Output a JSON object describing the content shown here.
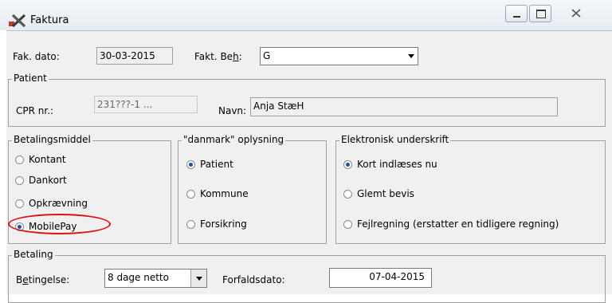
{
  "window": {
    "title": "Faktura",
    "icon": "faktura-x-icon"
  },
  "header": {
    "fak_dato_label": "Fak. dato:",
    "fak_dato_value": "30-03-2015",
    "fakt_beh_label_pre": "Fakt. Be",
    "fakt_beh_label_u": "h",
    "fakt_beh_label_post": ":",
    "fakt_beh_value": "G"
  },
  "patient": {
    "legend": "Patient",
    "cpr_label": "CPR nr.:",
    "cpr_value": "231???-1 ...",
    "navn_label": "Navn:",
    "navn_value": "Anja StæH"
  },
  "betalingsmiddel": {
    "legend": "Betalingsmiddel",
    "options": [
      "Kontant",
      "Dankort",
      "Opkrævning",
      "MobilePay"
    ],
    "selected": "MobilePay"
  },
  "danmark": {
    "legend": "\"danmark\" oplysning",
    "options": [
      "Patient",
      "Kommune",
      "Forsikring"
    ],
    "selected": "Patient"
  },
  "underskrift": {
    "legend": "Elektronisk underskrift",
    "options": [
      "Kort indlæses nu",
      "Glemt bevis",
      "Fejlregning (erstatter en tidligere regning)"
    ],
    "selected": "Kort indlæses nu"
  },
  "betaling": {
    "legend": "Betaling",
    "betingelse_label_pre": "B",
    "betingelse_label_u": "e",
    "betingelse_label_post": "tingelse:",
    "betingelse_value": "8 dage netto",
    "forfald_label": "Forfaldsdato:",
    "forfald_value": "07-04-2015"
  },
  "annotation": {
    "color": "#e01010",
    "target": "MobilePay"
  }
}
